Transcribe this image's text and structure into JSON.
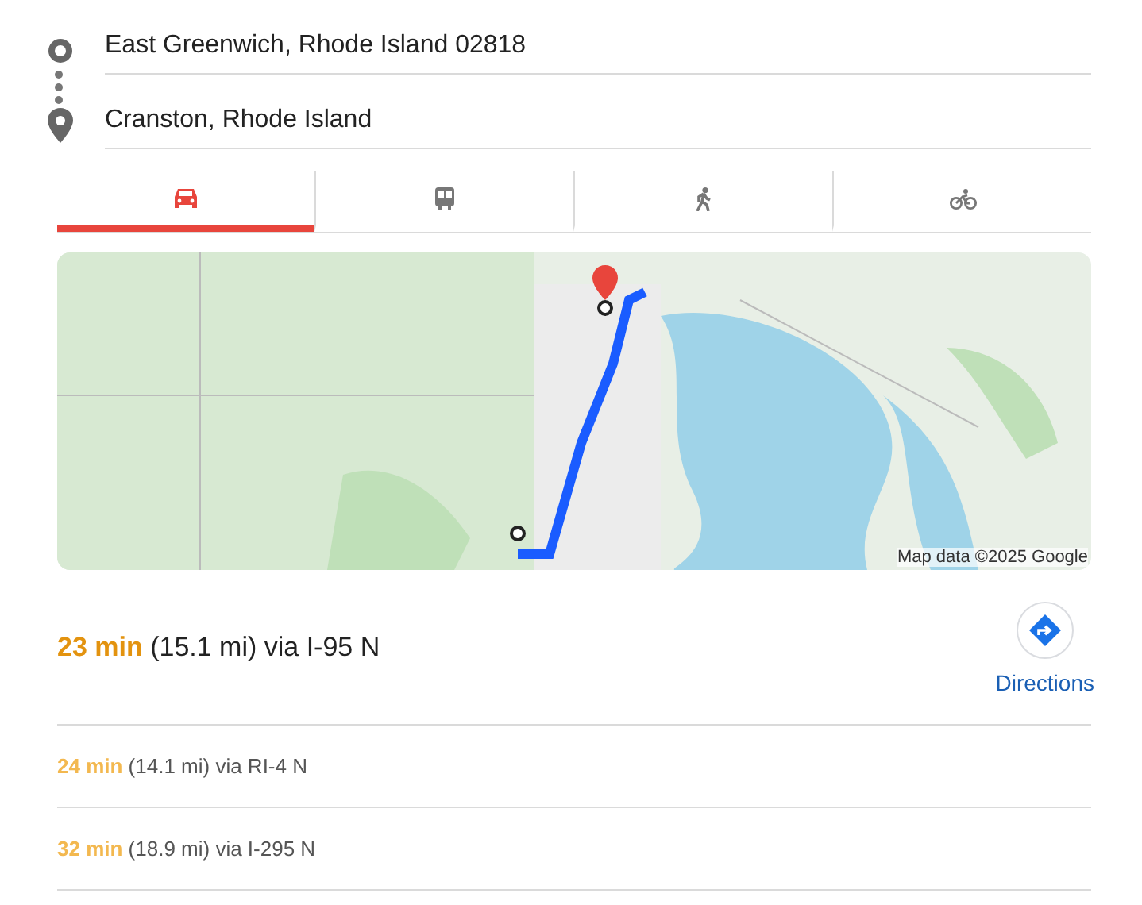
{
  "stops": [
    {
      "kind": "origin",
      "value": "East Greenwich, Rhode Island 02818"
    },
    {
      "kind": "destination",
      "value": "Cranston, Rhode Island"
    }
  ],
  "modes": [
    {
      "kind": "car",
      "selected": true
    },
    {
      "kind": "transit",
      "selected": false
    },
    {
      "kind": "walk",
      "selected": false
    },
    {
      "kind": "bike",
      "selected": false
    }
  ],
  "map": {
    "kind": "picture",
    "attribution": "Map data ©2025 Google"
  },
  "directions_button": {
    "label": "Directions"
  },
  "routes": [
    {
      "time": "23 min",
      "details": "(15.1 mi) via I-95 N",
      "selected": true
    },
    {
      "time": "24 min",
      "details": "(14.1 mi) via RI-4 N",
      "selected": false
    },
    {
      "time": "32 min",
      "details": "(18.9 mi) via I-295 N",
      "selected": false
    }
  ]
}
